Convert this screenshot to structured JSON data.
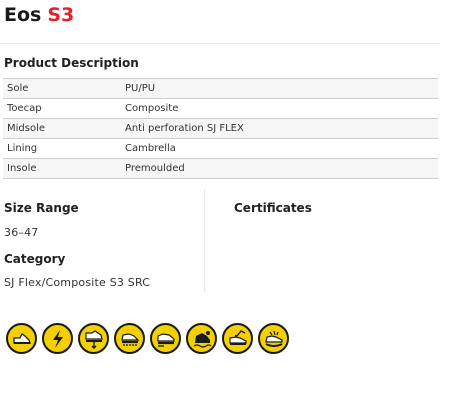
{
  "product": {
    "name": "Eos",
    "code": "S3"
  },
  "description": {
    "title": "Product Description",
    "rows": [
      {
        "key": "Sole",
        "value": "PU/PU"
      },
      {
        "key": "Toecap",
        "value": "Composite"
      },
      {
        "key": "Midsole",
        "value": "Anti perforation SJ FLEX"
      },
      {
        "key": "Lining",
        "value": "Cambrella"
      },
      {
        "key": "Insole",
        "value": "Premoulded"
      }
    ]
  },
  "size_range": {
    "title": "Size Range",
    "value": "36–47"
  },
  "category": {
    "title": "Category",
    "value": "SJ Flex/Composite S3 SRC"
  },
  "certificates": {
    "title": "Certificates"
  },
  "feature_icons": [
    "toecap-protection-icon",
    "antistatic-icon",
    "anti-perforation-icon",
    "slip-resistant-sole-icon",
    "energy-absorbing-heel-icon",
    "water-resistant-icon",
    "fuel-oil-resistant-icon",
    "flexible-sole-icon"
  ],
  "colors": {
    "accent": "#e5202e",
    "icon_fill": "#f4d000",
    "icon_stroke": "#1a1a1a"
  }
}
